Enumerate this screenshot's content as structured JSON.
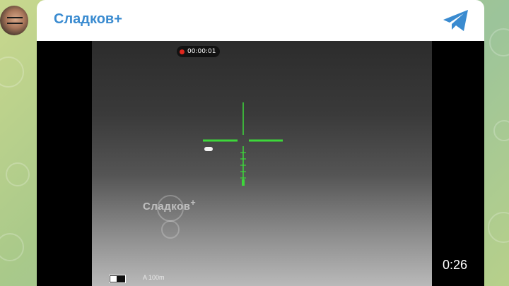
{
  "post": {
    "channel_name": "Сладков+",
    "avatar_icon": "avatar-icon",
    "app_icon": "telegram-logo-icon",
    "accent_color": "#3a8bd0"
  },
  "video": {
    "duration": "0:26",
    "recording_time": "00:00:01",
    "recording_color": "#e0281e",
    "watermark": "Сладков",
    "watermark_sup": "+",
    "range": "A 100m",
    "battery_level": 0.45,
    "reticle_color": "#3dd83a"
  }
}
